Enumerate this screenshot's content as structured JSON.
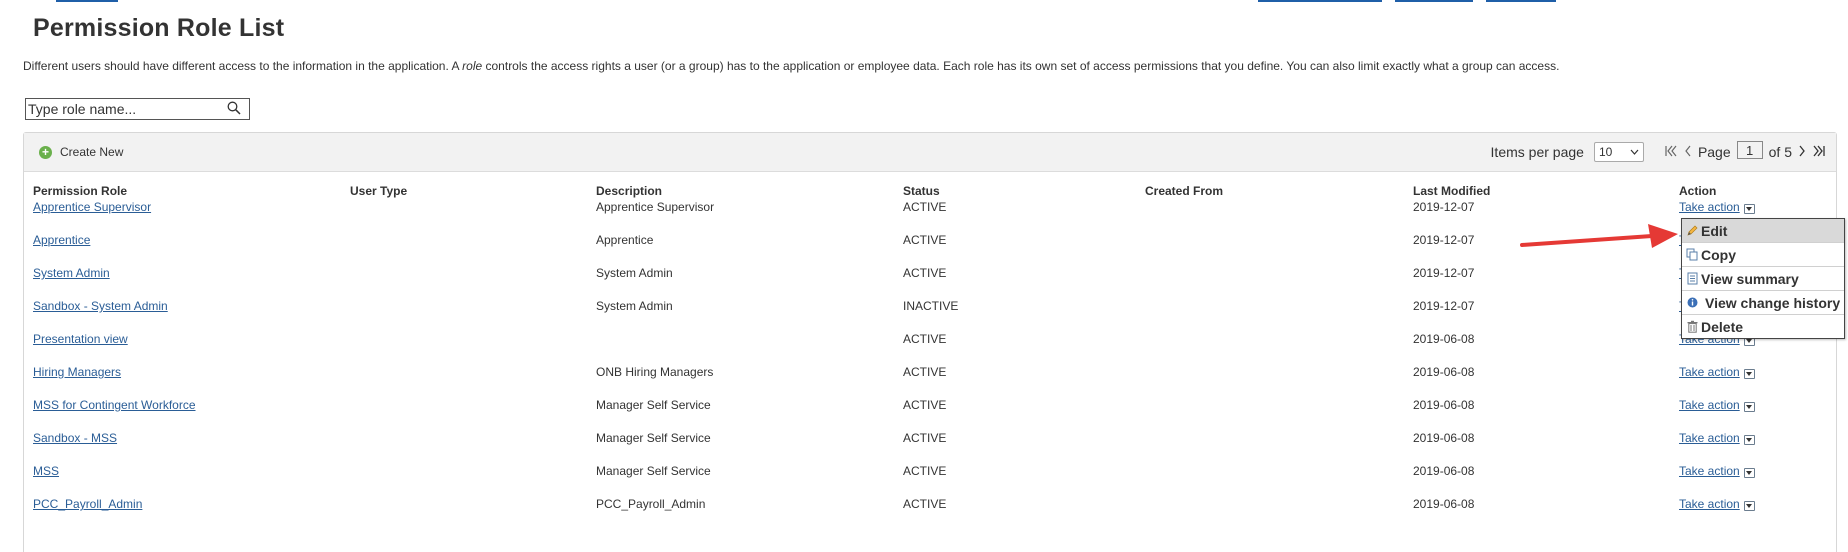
{
  "page": {
    "title": "Permission Role List",
    "description_before": "Different users should have different access to the information in the application. A ",
    "description_em": "role",
    "description_after": " controls the access rights a user (or a group) has to the application or employee data. Each role has its own set of access permissions that you define. You can also limit exactly what a group can access."
  },
  "search": {
    "placeholder": "Type role name...",
    "value": "",
    "icon": "search-icon"
  },
  "toolbar": {
    "create_new_label": "Create New",
    "items_per_page_label": "Items per page",
    "items_per_page_value": "10",
    "page_label": "Page",
    "current_page": "1",
    "of_label": "of 5"
  },
  "table": {
    "headers": {
      "role": "Permission Role",
      "user_type": "User Type",
      "description": "Description",
      "status": "Status",
      "created_from": "Created From",
      "last_modified": "Last Modified",
      "action": "Action"
    },
    "action_label": "Take action",
    "rows": [
      {
        "role": "Apprentice Supervisor",
        "user_type": "",
        "description": "Apprentice Supervisor",
        "status": "ACTIVE",
        "created_from": "",
        "last_modified": "2019-12-07"
      },
      {
        "role": "Apprentice",
        "user_type": "",
        "description": "Apprentice",
        "status": "ACTIVE",
        "created_from": "",
        "last_modified": "2019-12-07"
      },
      {
        "role": "System Admin",
        "user_type": "",
        "description": "System Admin",
        "status": "ACTIVE",
        "created_from": "",
        "last_modified": "2019-12-07"
      },
      {
        "role": "Sandbox - System Admin",
        "user_type": "",
        "description": "System Admin",
        "status": "INACTIVE",
        "created_from": "",
        "last_modified": "2019-12-07"
      },
      {
        "role": "Presentation view",
        "user_type": "",
        "description": "",
        "status": "ACTIVE",
        "created_from": "",
        "last_modified": "2019-06-08"
      },
      {
        "role": "Hiring Managers",
        "user_type": "",
        "description": "ONB Hiring Managers",
        "status": "ACTIVE",
        "created_from": "",
        "last_modified": "2019-06-08"
      },
      {
        "role": "MSS for Contingent Workforce",
        "user_type": "",
        "description": "Manager Self Service",
        "status": "ACTIVE",
        "created_from": "",
        "last_modified": "2019-06-08"
      },
      {
        "role": "Sandbox - MSS",
        "user_type": "",
        "description": "Manager Self Service",
        "status": "ACTIVE",
        "created_from": "",
        "last_modified": "2019-06-08"
      },
      {
        "role": "MSS",
        "user_type": "",
        "description": "Manager Self Service",
        "status": "ACTIVE",
        "created_from": "",
        "last_modified": "2019-06-08"
      },
      {
        "role": "PCC_Payroll_Admin",
        "user_type": "",
        "description": "PCC_Payroll_Admin",
        "status": "ACTIVE",
        "created_from": "",
        "last_modified": "2019-06-08"
      }
    ]
  },
  "action_menu": {
    "items": [
      {
        "label": "Edit",
        "icon": "pencil-icon",
        "active": true
      },
      {
        "label": "Copy",
        "icon": "copy-icon"
      },
      {
        "label": "View summary",
        "icon": "document-icon"
      },
      {
        "label": "View change history",
        "icon": "info-icon"
      },
      {
        "label": "Delete",
        "icon": "trash-icon"
      }
    ]
  },
  "colors": {
    "link": "#2a5d96",
    "arrow": "#e53935",
    "create_icon": "#6ab04c"
  }
}
